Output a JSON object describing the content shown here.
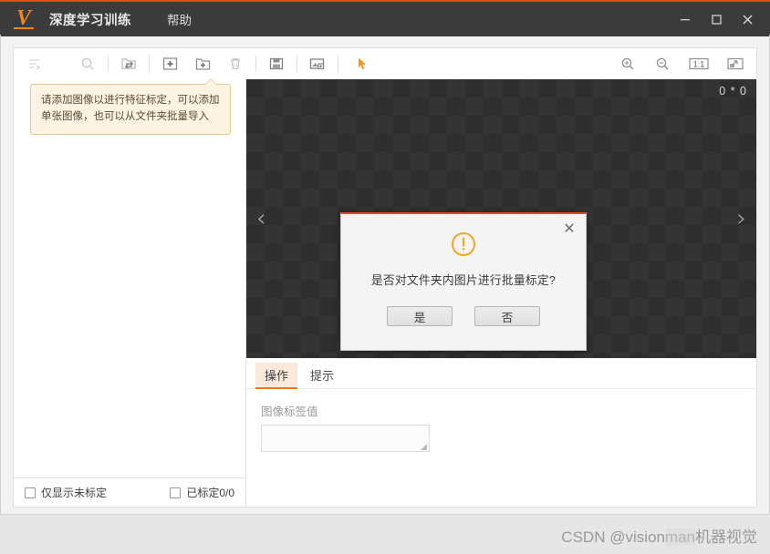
{
  "window": {
    "app_title": "深度学习训练",
    "logo_letter": "V",
    "menu": [
      {
        "label": "帮助",
        "name": "menu-help"
      }
    ],
    "controls": {
      "minimize": "minimize-icon",
      "maximize": "maximize-icon",
      "close": "close-icon"
    }
  },
  "toolbar": {
    "left_tools": [
      {
        "name": "filter-sort-icon",
        "title": "筛选"
      },
      {
        "name": "search-icon",
        "title": "搜索"
      },
      {
        "name": "folder-swap-icon",
        "title": "切换文件夹"
      },
      {
        "name": "add-image-icon",
        "title": "添加图像"
      },
      {
        "name": "add-folder-icon",
        "title": "添加文件夹"
      },
      {
        "name": "delete-icon",
        "title": "删除"
      },
      {
        "name": "save-icon",
        "title": "保存"
      },
      {
        "name": "export-image-icon",
        "title": "导出图像"
      },
      {
        "name": "pointer-tool-icon",
        "title": "选择工具"
      }
    ],
    "right_tools": [
      {
        "name": "zoom-in-icon",
        "title": "放大"
      },
      {
        "name": "zoom-out-icon",
        "title": "缩小"
      },
      {
        "name": "actual-size-icon",
        "title": "1:1",
        "label": "1:1"
      },
      {
        "name": "fit-window-icon",
        "title": "适应窗口"
      }
    ]
  },
  "left_panel": {
    "tooltip": "请添加图像以进行特征标定，可以添加单张图像，也可以从文件夹批量导入",
    "footer": {
      "show_unlabeled_label": "仅显示未标定",
      "labeled_count_label": "已标定0/0"
    }
  },
  "canvas": {
    "size_text": "0 * 0",
    "prev_chevron": "‹",
    "next_chevron": "›"
  },
  "bottom_panel": {
    "tabs": [
      {
        "label": "操作",
        "active": true
      },
      {
        "label": "提示",
        "active": false
      }
    ],
    "form": {
      "label_value_title": "图像标签值",
      "label_value": "",
      "label_value_placeholder": ""
    }
  },
  "statusbar": {
    "watermark_prefix": "CSDN @vision",
    "watermark_highlight": "man",
    "watermark_suffix": "机器视觉"
  },
  "modal": {
    "icon": "warning-exclamation-icon",
    "message": "是否对文件夹内图片进行批量标定?",
    "confirm_label": "是",
    "cancel_label": "否",
    "close_glyph": "✕"
  },
  "colors": {
    "accent": "#f07814",
    "titlebar": "#3b3b3b",
    "top_border": "#e8491f",
    "warning": "#f5a623",
    "canvas_dark": "#2e2e2e",
    "canvas_light": "#343434"
  }
}
